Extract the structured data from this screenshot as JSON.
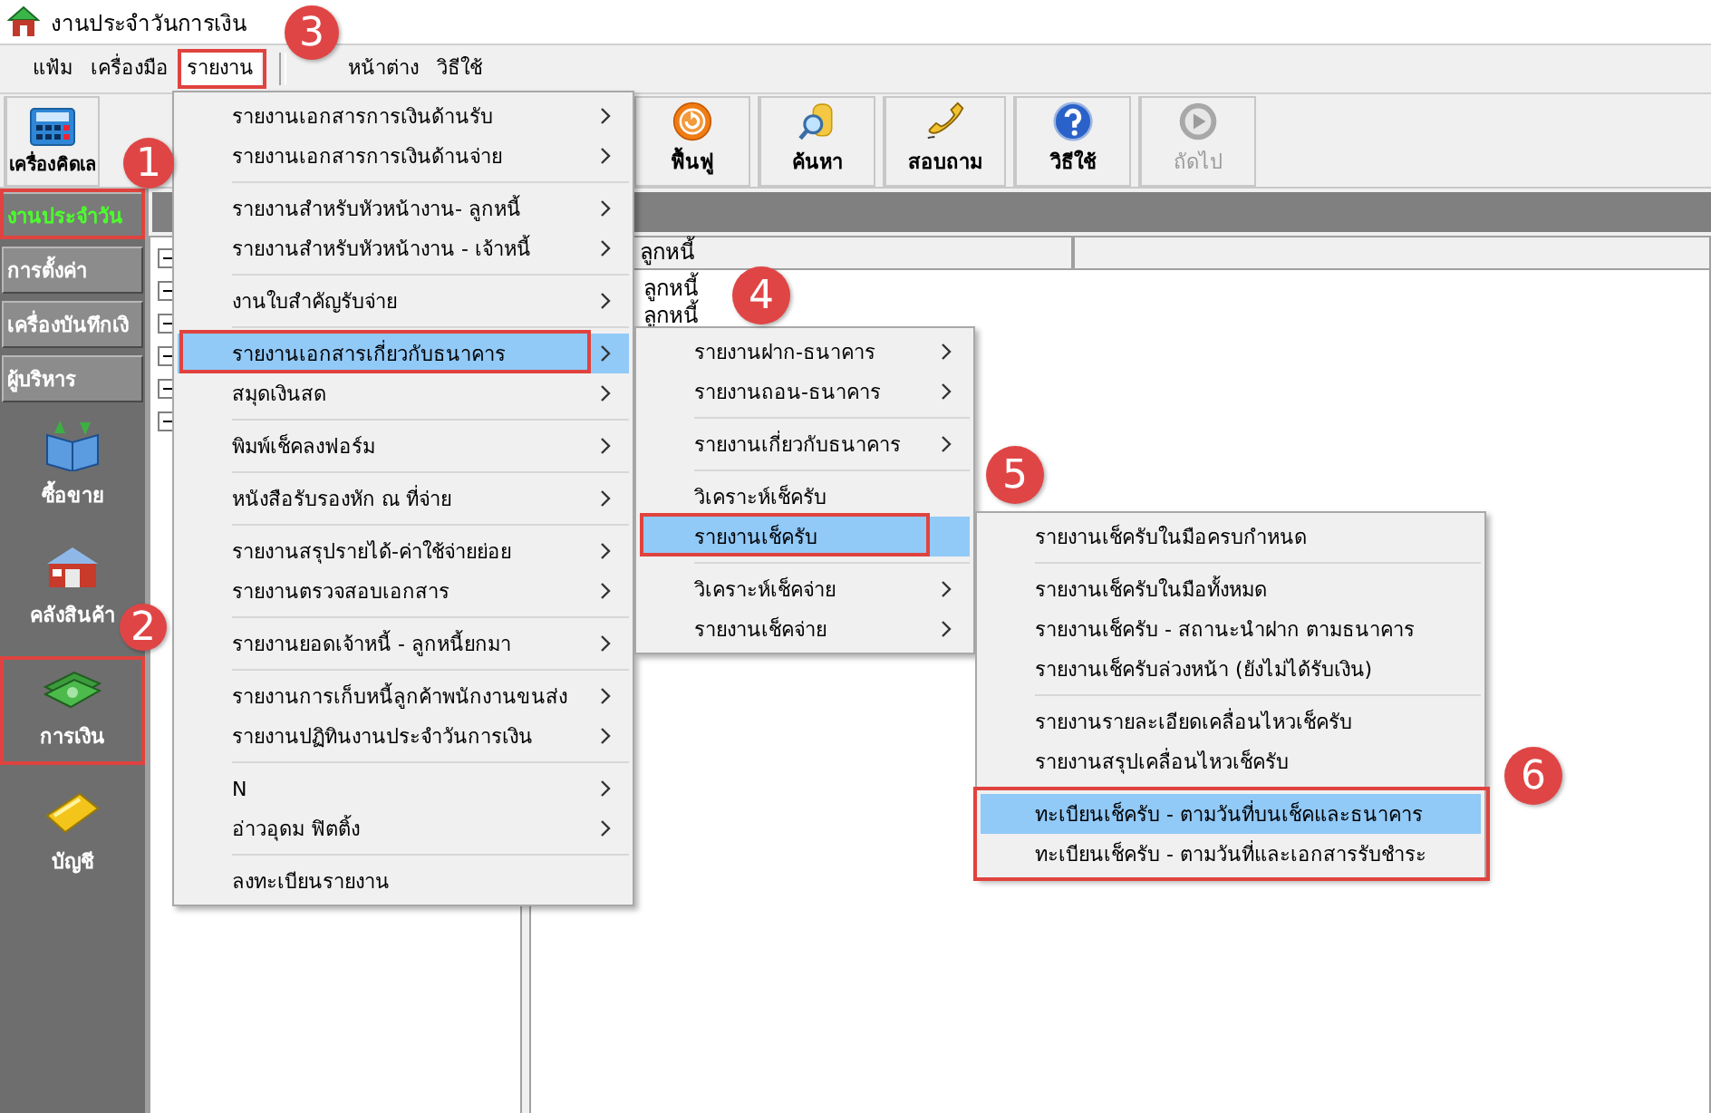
{
  "window": {
    "title": "งานประจำวันการเงิน"
  },
  "menu_bar": [
    {
      "label": "แฟ้ม",
      "selected": false
    },
    {
      "label": "เครื่องมือ",
      "selected": false
    },
    {
      "label": "รายงาน",
      "selected": true
    },
    {
      "label": "หน้าต่าง",
      "selected": false
    },
    {
      "label": "วิธีใช้",
      "selected": false
    }
  ],
  "toolbar": [
    {
      "label": "เครื่องคิดเล",
      "kind": "calculator",
      "disabled": false
    },
    {
      "label": "ฟื้นฟู",
      "kind": "refresh",
      "disabled": false
    },
    {
      "label": "ค้นหา",
      "kind": "search",
      "disabled": false
    },
    {
      "label": "สอบถาม",
      "kind": "phone",
      "disabled": false
    },
    {
      "label": "วิธีใช้",
      "kind": "help",
      "disabled": false
    },
    {
      "label": "ถัดไป",
      "kind": "next",
      "disabled": true
    }
  ],
  "sidebar": {
    "sections": [
      {
        "label": "งานประจำวัน",
        "selected": true
      },
      {
        "label": "การตั้งค่า",
        "selected": false
      },
      {
        "label": "เครื่องบันทึกเงิ",
        "selected": false
      },
      {
        "label": "ผู้บริหาร",
        "selected": false
      }
    ],
    "modules": [
      {
        "label": "ซื้อขาย",
        "kind": "book"
      },
      {
        "label": "คลังสินค้า",
        "kind": "warehouse"
      },
      {
        "label": "การเงิน",
        "kind": "money"
      },
      {
        "label": "บัญชี",
        "kind": "ledger"
      }
    ]
  },
  "tree_nodes": [
    {
      "expanded": true
    },
    {
      "expanded": true
    },
    {
      "expanded": true
    },
    {
      "expanded": true
    },
    {
      "expanded": true
    },
    {
      "expanded": true
    }
  ],
  "list": {
    "columns": [
      {
        "label": "ลูกหนี้"
      }
    ],
    "rows": [
      [
        "ลูกหนี้"
      ],
      [
        "ลูกหนี้"
      ]
    ]
  },
  "menus": [
    {
      "groups": [
        [
          {
            "label": "รายงานเอกสารการเงินด้านรับ",
            "submenu": true,
            "selected": false
          },
          {
            "label": "รายงานเอกสารการเงินด้านจ่าย",
            "submenu": true,
            "selected": false
          }
        ],
        [
          {
            "label": "รายงานสำหรับหัวหน้างาน- ลูกหนี้",
            "submenu": true,
            "selected": false
          },
          {
            "label": "รายงานสำหรับหัวหน้างาน - เจ้าหนี้",
            "submenu": true,
            "selected": false
          }
        ],
        [
          {
            "label": "งานใบสำคัญรับจ่าย",
            "submenu": true,
            "selected": false
          }
        ],
        [
          {
            "label": "รายงานเอกสารเกี่ยวกับธนาคาร",
            "submenu": true,
            "selected": true
          },
          {
            "label": "สมุดเงินสด",
            "submenu": true,
            "selected": false
          }
        ],
        [
          {
            "label": "พิมพ์เช็คลงฟอร์ม",
            "submenu": true,
            "selected": false
          }
        ],
        [
          {
            "label": "หนังสือรับรองหัก ณ ที่จ่าย",
            "submenu": true,
            "selected": false
          }
        ],
        [
          {
            "label": "รายงานสรุปรายได้-ค่าใช้จ่ายย่อย",
            "submenu": true,
            "selected": false
          },
          {
            "label": "รายงานตรวจสอบเอกสาร",
            "submenu": true,
            "selected": false
          }
        ],
        [
          {
            "label": "รายงานยอดเจ้าหนี้  - ลูกหนี้ยกมา",
            "submenu": true,
            "selected": false
          }
        ],
        [
          {
            "label": "รายงานการเก็บหนี้ลูกค้าพนักงานขนส่ง",
            "submenu": true,
            "selected": false
          },
          {
            "label": "รายงานปฏิทินงานประจำวันการเงิน",
            "submenu": true,
            "selected": false
          }
        ],
        [
          {
            "label": "N",
            "submenu": true,
            "selected": false
          },
          {
            "label": "อ่าวอุดม ฟิตติ้ง",
            "submenu": true,
            "selected": false
          }
        ],
        [
          {
            "label": "ลงทะเบียนรายงาน",
            "submenu": false,
            "selected": false
          }
        ]
      ]
    },
    {
      "groups": [
        [
          {
            "label": "รายงานฝาก-ธนาคาร",
            "submenu": true,
            "selected": false
          },
          {
            "label": "รายงานถอน-ธนาคาร",
            "submenu": true,
            "selected": false
          }
        ],
        [
          {
            "label": "รายงานเกี่ยวกับธนาคาร",
            "submenu": true,
            "selected": false
          }
        ],
        [
          {
            "label": "วิเคราะห์เช็ครับ",
            "submenu": false,
            "selected": false
          },
          {
            "label": "รายงานเช็ครับ",
            "submenu": false,
            "selected": true
          }
        ],
        [
          {
            "label": "วิเคราะห์เช็คจ่าย",
            "submenu": true,
            "selected": false
          },
          {
            "label": "รายงานเช็คจ่าย",
            "submenu": true,
            "selected": false
          }
        ]
      ]
    },
    {
      "groups": [
        [
          {
            "label": "รายงานเช็ครับในมือครบกำหนด",
            "submenu": false,
            "selected": false
          }
        ],
        [
          {
            "label": "รายงานเช็ครับในมือทั้งหมด",
            "submenu": false,
            "selected": false
          },
          {
            "label": "รายงานเช็ครับ - สถานะนำฝาก ตามธนาคาร",
            "submenu": false,
            "selected": false
          },
          {
            "label": "รายงานเช็ครับล่วงหน้า (ยังไม่ได้รับเงิน)",
            "submenu": false,
            "selected": false
          }
        ],
        [
          {
            "label": "รายงานรายละเอียดเคลื่อนไหวเช็ครับ",
            "submenu": false,
            "selected": false
          },
          {
            "label": "รายงานสรุปเคลื่อนไหวเช็ครับ",
            "submenu": false,
            "selected": false
          }
        ],
        [
          {
            "label": "ทะเบียนเช็ครับ - ตามวันที่บนเช็คและธนาคาร",
            "submenu": false,
            "selected": true
          },
          {
            "label": "ทะเบียนเช็ครับ - ตามวันที่และเอกสารรับชำระ",
            "submenu": false,
            "selected": false
          }
        ]
      ]
    }
  ],
  "annotations": [
    {
      "number": "1"
    },
    {
      "number": "2"
    },
    {
      "number": "3"
    },
    {
      "number": "4"
    },
    {
      "number": "5"
    },
    {
      "number": "6"
    }
  ]
}
